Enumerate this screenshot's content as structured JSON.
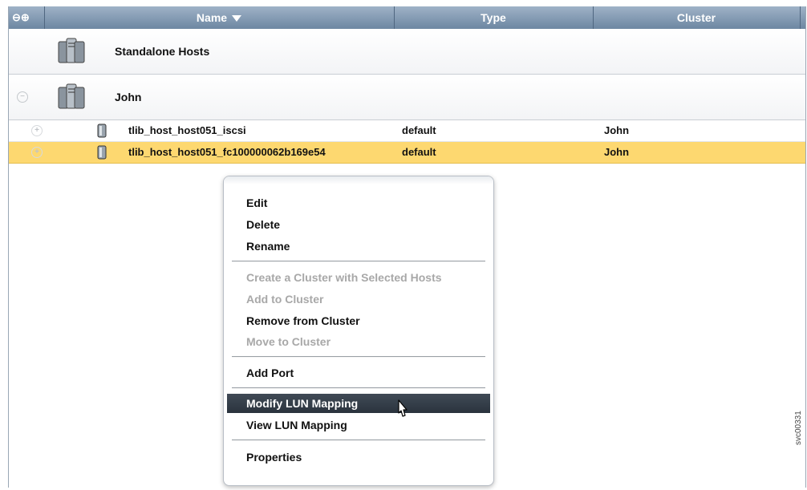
{
  "table": {
    "columns": {
      "name": "Name",
      "type": "Type",
      "cluster": "Cluster"
    },
    "groups": [
      {
        "label": "Standalone Hosts"
      },
      {
        "label": "John"
      }
    ],
    "hosts": [
      {
        "name": "tlib_host_host051_iscsi",
        "type": "default",
        "cluster": "John",
        "selected": false
      },
      {
        "name": "tlib_host_host051_fc100000062b169e54",
        "type": "default",
        "cluster": "John",
        "selected": true
      }
    ]
  },
  "context_menu": {
    "items": [
      {
        "label": "Edit",
        "enabled": true
      },
      {
        "label": "Delete",
        "enabled": true
      },
      {
        "label": "Rename",
        "enabled": true
      },
      {
        "label": "Create a Cluster with Selected Hosts",
        "enabled": false
      },
      {
        "label": "Add to Cluster",
        "enabled": false
      },
      {
        "label": "Remove from Cluster",
        "enabled": true
      },
      {
        "label": "Move to Cluster",
        "enabled": false
      },
      {
        "label": "Add Port",
        "enabled": true
      },
      {
        "label": "Modify LUN Mapping",
        "enabled": true,
        "highlighted": true
      },
      {
        "label": "View LUN Mapping",
        "enabled": true
      },
      {
        "label": "Properties",
        "enabled": true
      }
    ]
  },
  "side_mark": "svc00331",
  "colors": {
    "header": "#6d87a2",
    "selected_row": "#fdd870",
    "menu_highlight": "#2a333d"
  }
}
